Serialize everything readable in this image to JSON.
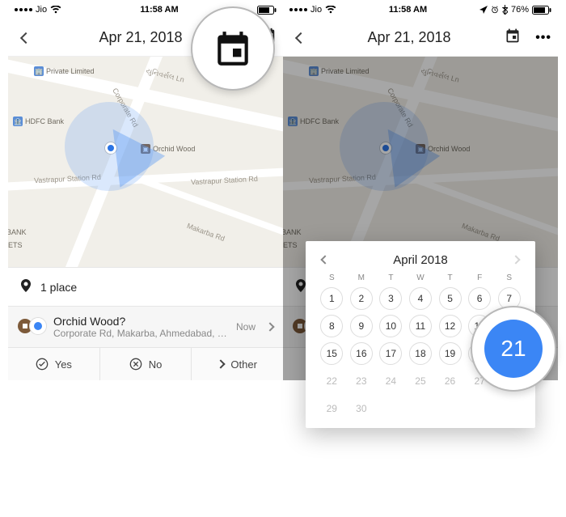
{
  "status": {
    "carrier": "Jio",
    "time": "11:58 AM",
    "battery_pct": "76%"
  },
  "header": {
    "date_title": "Apr 21, 2018"
  },
  "map": {
    "pois": {
      "private_ltd": "Private Limited",
      "hdfc": "HDFC Bank",
      "orchid": "Orchid Wood",
      "bank": "BANK",
      "ets": "ETS"
    },
    "roads": {
      "corporate": "Corporate Rd",
      "vastrapur": "Vastrapur Station Rd",
      "makarba": "Makarba Rd",
      "universal": "યુનિવર્સલ Ln"
    }
  },
  "places_section": {
    "count_label": "1 place"
  },
  "item": {
    "name": "Orchid Wood?",
    "address": "Corporate Rd, Makarba, Ahmedabad, Gujarat...",
    "now": "Now"
  },
  "answers": {
    "yes": "Yes",
    "no": "No",
    "other": "Other"
  },
  "calendar": {
    "month_label": "April 2018",
    "dow": [
      "S",
      "M",
      "T",
      "W",
      "T",
      "F",
      "S"
    ],
    "first_weekday": 0,
    "days_in_month": 30,
    "today": 21,
    "selected": 21
  },
  "highlight": {
    "day_label": "21"
  }
}
